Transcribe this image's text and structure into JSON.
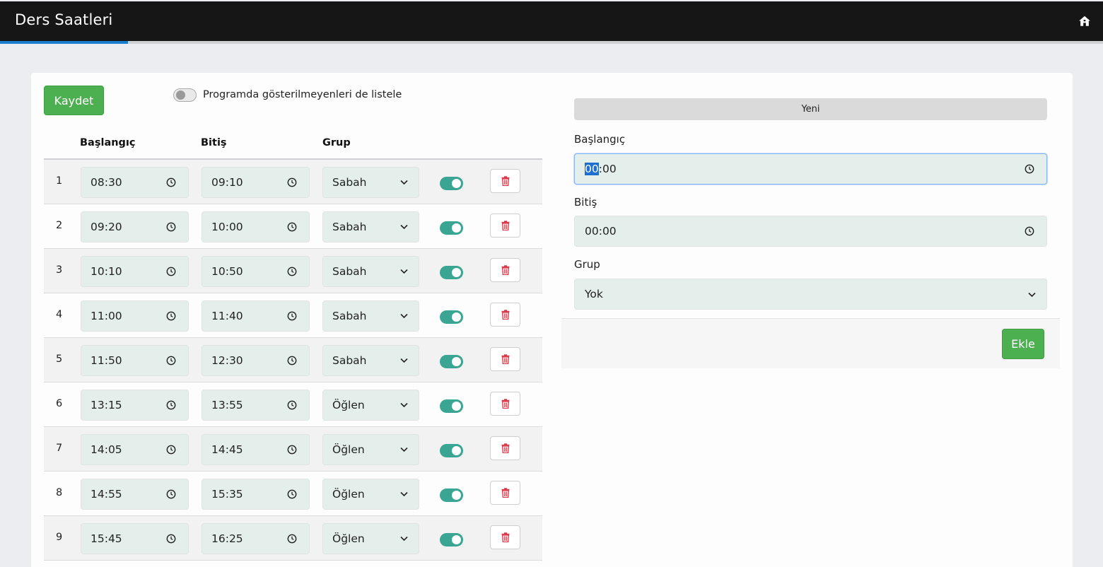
{
  "header": {
    "title": "Ders Saatleri",
    "progress_fraction": 0.116
  },
  "toolbar": {
    "save_label": "Kaydet",
    "show_hidden_label": "Programda gösterilmeyenleri de listele",
    "show_hidden_on": false
  },
  "table": {
    "columns": {
      "start": "Başlangıç",
      "end": "Bitiş",
      "group": "Grup"
    },
    "rows": [
      {
        "no": "1",
        "start": "08:30",
        "end": "09:10",
        "group": "Sabah",
        "visible": true
      },
      {
        "no": "2",
        "start": "09:20",
        "end": "10:00",
        "group": "Sabah",
        "visible": true
      },
      {
        "no": "3",
        "start": "10:10",
        "end": "10:50",
        "group": "Sabah",
        "visible": true
      },
      {
        "no": "4",
        "start": "11:00",
        "end": "11:40",
        "group": "Sabah",
        "visible": true
      },
      {
        "no": "5",
        "start": "11:50",
        "end": "12:30",
        "group": "Sabah",
        "visible": true
      },
      {
        "no": "6",
        "start": "13:15",
        "end": "13:55",
        "group": "Öğlen",
        "visible": true
      },
      {
        "no": "7",
        "start": "14:05",
        "end": "14:45",
        "group": "Öğlen",
        "visible": true
      },
      {
        "no": "8",
        "start": "14:55",
        "end": "15:35",
        "group": "Öğlen",
        "visible": true
      },
      {
        "no": "9",
        "start": "15:45",
        "end": "16:25",
        "group": "Öğlen",
        "visible": true
      }
    ]
  },
  "form": {
    "header": "Yeni",
    "start_label": "Başlangıç",
    "start_hours": "00",
    "start_minutes": ":00",
    "end_label": "Bitiş",
    "end_value": "00:00",
    "group_label": "Grup",
    "group_value": "Yok",
    "add_label": "Ekle"
  },
  "icons": {
    "home": "home-icon",
    "clock": "clock-icon",
    "chevron": "chevron-down-icon",
    "delete": "trash-icon"
  },
  "colors": {
    "accent_green": "#4caf50",
    "toggle_on": "#3aa592",
    "delete_red": "#dc3545",
    "progress_blue": "#1a7dd0"
  }
}
